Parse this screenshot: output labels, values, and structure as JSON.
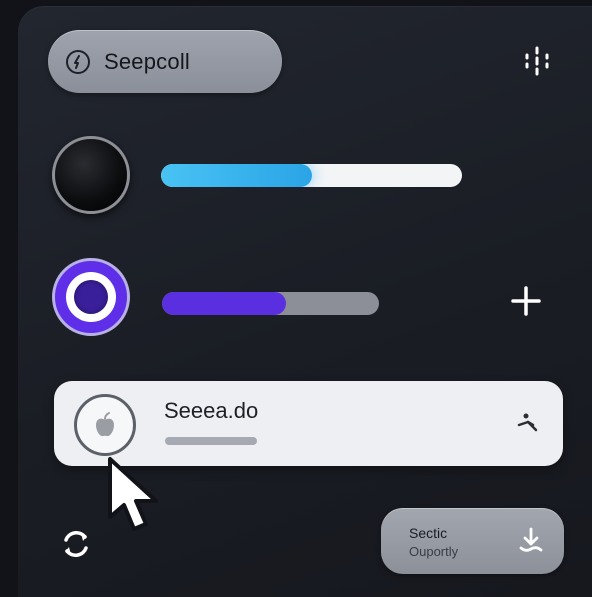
{
  "header": {
    "pill_button_label": "Seepcoll",
    "pill_button_icon": "power-icon",
    "grid_icon": "dots-grid-icon"
  },
  "sliders": [
    {
      "knob": "dark-knob",
      "level": 0.5,
      "fill_color": "#3bb5f0",
      "track_color": "#f3f4f6"
    },
    {
      "knob": "purple-radio-knob",
      "level": 0.57,
      "fill_color": "#5a2fe0",
      "track_color": "#8c8f98"
    }
  ],
  "add_icon": "plus-icon",
  "card": {
    "title": "Seeea.do",
    "avatar_icon": "apple-logo-icon",
    "side_icon": "person-reclining-icon"
  },
  "footer": {
    "refresh_icon": "refresh-icon",
    "download_button": {
      "title": "Sectic",
      "subtitle": "Ouportly",
      "icon": "download-icon"
    }
  }
}
